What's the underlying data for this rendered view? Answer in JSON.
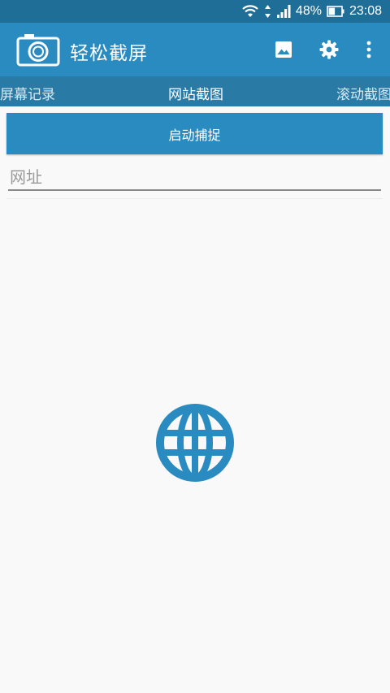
{
  "status": {
    "battery": "48%",
    "time": "23:08"
  },
  "appbar": {
    "title": "轻松截屏"
  },
  "tabs": [
    {
      "label": "屏幕记录"
    },
    {
      "label": "网站截图"
    },
    {
      "label": "滚动截图"
    }
  ],
  "main": {
    "capture_label": "启动捕捉",
    "url_placeholder": "网址"
  },
  "colors": {
    "primary": "#2a8bc0",
    "status_bar": "#1f6e98",
    "tab_bar": "#2a7aa6",
    "background": "#f9f9f9"
  },
  "icons": [
    "camera-icon",
    "image-icon",
    "gear-icon",
    "more-vert-icon",
    "globe-icon",
    "wifi-icon",
    "signal-icon",
    "battery-icon"
  ]
}
